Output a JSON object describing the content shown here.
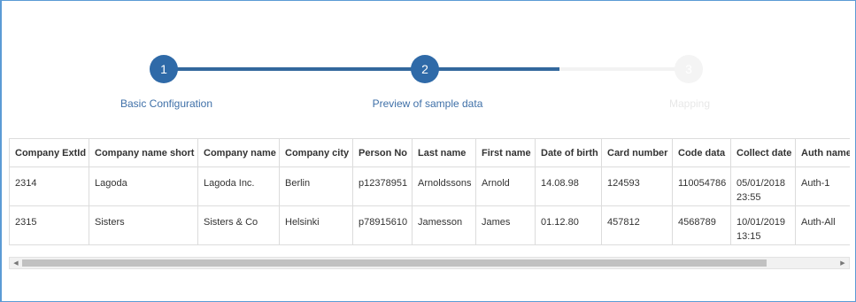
{
  "wizard": {
    "steps": [
      {
        "number": "1",
        "label": "Basic Configuration",
        "state": "completed"
      },
      {
        "number": "2",
        "label": "Preview of sample data",
        "state": "current"
      },
      {
        "number": "3",
        "label": "Mapping",
        "state": "pending"
      }
    ],
    "progress_color": "#33689d",
    "pending_color": "#f2f2f2"
  },
  "table": {
    "columns": [
      "Company ExtId",
      "Company name short",
      "Company name",
      "Company city",
      "Person No",
      "Last name",
      "First name",
      "Date of birth",
      "Card number",
      "Code data",
      "Collect date",
      "Auth name"
    ],
    "rows": [
      [
        "2314",
        "Lagoda",
        "Lagoda Inc.",
        "Berlin",
        "p12378951",
        "Arnoldssons",
        "Arnold",
        "14.08.98",
        "124593",
        "110054786",
        "05/01/2018 23:55",
        "Auth-1"
      ],
      [
        "2315",
        "Sisters",
        "Sisters & Co",
        "Helsinki",
        "p78915610",
        "Jamesson",
        "James",
        "01.12.80",
        "457812",
        "4568789",
        "10/01/2019 13:15",
        "Auth-All"
      ]
    ]
  },
  "scrollbar": {
    "left_arrow": "◀",
    "right_arrow": "▶"
  }
}
